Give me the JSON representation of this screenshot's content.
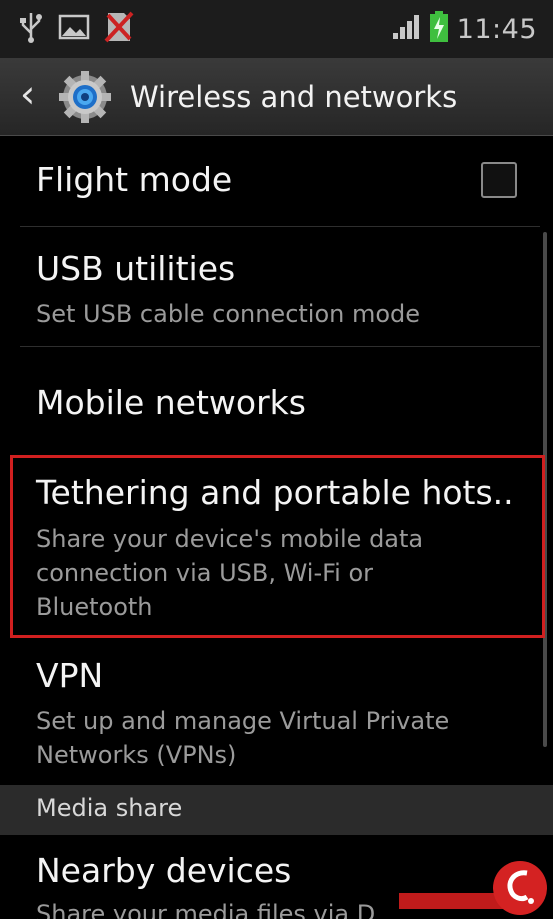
{
  "status_bar": {
    "time": "11:45",
    "icons": [
      "usb-icon",
      "image-icon",
      "no-sim-icon",
      "signal-icon",
      "battery-charging-icon"
    ]
  },
  "action_bar": {
    "back_icon": "chevron-left-icon",
    "settings_icon": "gear-icon",
    "title": "Wireless and networks"
  },
  "items": [
    {
      "title": "Flight mode",
      "checkbox_checked": false
    },
    {
      "title": "USB utilities",
      "subtitle": "Set USB cable connection mode"
    },
    {
      "title": "Mobile networks"
    },
    {
      "title": "Tethering and portable hots..",
      "subtitle_lines": [
        "Share your device's mobile data",
        "connection via USB, Wi-Fi or",
        "Bluetooth"
      ]
    },
    {
      "title": "VPN",
      "subtitle_lines": [
        "Set up and manage Virtual Private",
        "Networks (VPNs)"
      ]
    }
  ],
  "section": {
    "label": "Media share"
  },
  "nearby": {
    "title": "Nearby devices",
    "subtitle": "Share your media files via D"
  },
  "colors": {
    "highlight_border": "#d01f1f",
    "background": "#000000",
    "accent_blue": "#2f8fe0"
  }
}
